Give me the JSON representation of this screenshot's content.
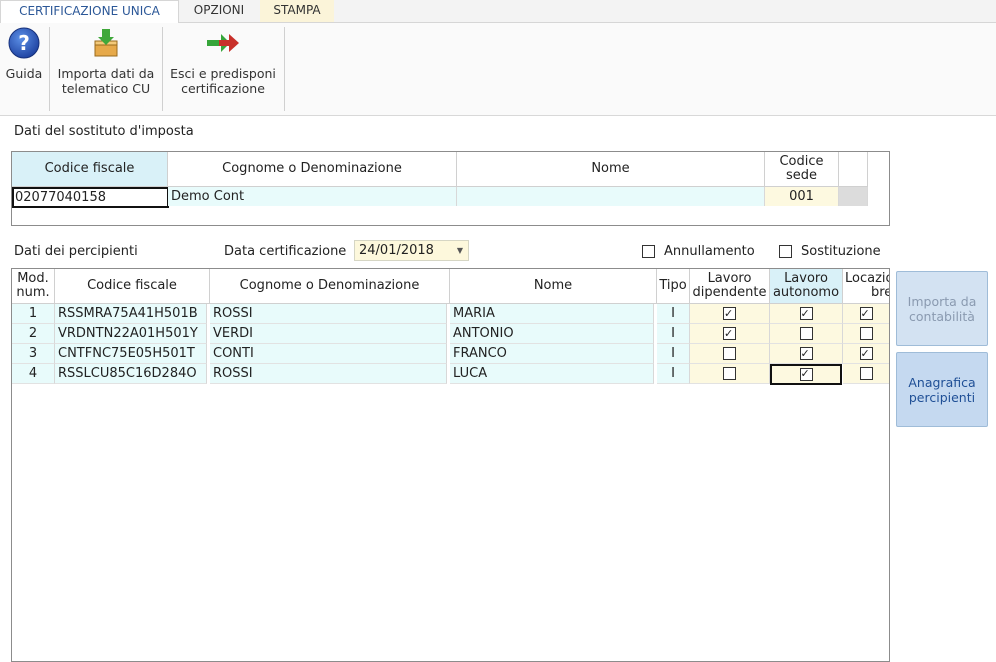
{
  "tabs": [
    {
      "label": "CERTIFICAZIONE UNICA"
    },
    {
      "label": "OPZIONI"
    },
    {
      "label": "STAMPA"
    }
  ],
  "ribbon": {
    "guida": "Guida",
    "importa_line1": "Importa dati da",
    "importa_line2": "telematico CU",
    "esci_line1": "Esci e predisponi",
    "esci_line2": "certificazione"
  },
  "sostituto": {
    "section_label": "Dati del sostituto d'imposta",
    "headers": {
      "codice_fiscale": "Codice fiscale",
      "cognome": "Cognome o Denominazione",
      "nome": "Nome",
      "codice_sede_1": "Codice",
      "codice_sede_2": "sede"
    },
    "row": {
      "codice_fiscale": "02077040158",
      "cognome": "Demo Cont",
      "nome": "",
      "codice_sede": "001"
    }
  },
  "percipienti_bar": {
    "section_label": "Dati dei percipienti",
    "data_label": "Data certificazione",
    "data_value": "24/01/2018",
    "annullamento": "Annullamento",
    "sostituzione": "Sostituzione",
    "annullamento_checked": false,
    "sostituzione_checked": false
  },
  "grid": {
    "headers": {
      "mod_1": "Mod.",
      "mod_2": "num.",
      "codice_fiscale": "Codice fiscale",
      "cognome": "Cognome o Denominazione",
      "nome": "Nome",
      "tipo": "Tipo",
      "dip_1": "Lavoro",
      "dip_2": "dipendente",
      "aut_1": "Lavoro",
      "aut_2": "autonomo",
      "loc_1": "Locazioni",
      "loc_2": "brevi"
    },
    "rows": [
      {
        "num": "1",
        "cf": "RSSMRA75A41H501B",
        "cognome": "ROSSI",
        "nome": "MARIA",
        "tipo": "I",
        "dip": true,
        "aut": true,
        "loc": true
      },
      {
        "num": "2",
        "cf": "VRDNTN22A01H501Y",
        "cognome": "VERDI",
        "nome": "ANTONIO",
        "tipo": "I",
        "dip": true,
        "aut": false,
        "loc": false
      },
      {
        "num": "3",
        "cf": "CNTFNC75E05H501T",
        "cognome": "CONTI",
        "nome": "FRANCO",
        "tipo": "I",
        "dip": false,
        "aut": true,
        "loc": true
      },
      {
        "num": "4",
        "cf": "RSSLCU85C16D284O",
        "cognome": "ROSSI",
        "nome": "LUCA",
        "tipo": "I",
        "dip": false,
        "aut": true,
        "loc": false
      }
    ]
  },
  "side_buttons": {
    "importa_1": "Importa da",
    "importa_2": "contabilità",
    "anagrafica_1": "Anagrafica",
    "anagrafica_2": "percipienti"
  },
  "colors": {
    "tab_accent": "#2b5797",
    "cell_cyan": "#e8fbfb",
    "cell_yellow": "#fdf9e0",
    "side_button_blue": "#c8daf0"
  },
  "icons": [
    "help-icon",
    "import-icon",
    "exit-arrow-icon",
    "dropdown-arrow-icon",
    "checkbox-icon"
  ]
}
